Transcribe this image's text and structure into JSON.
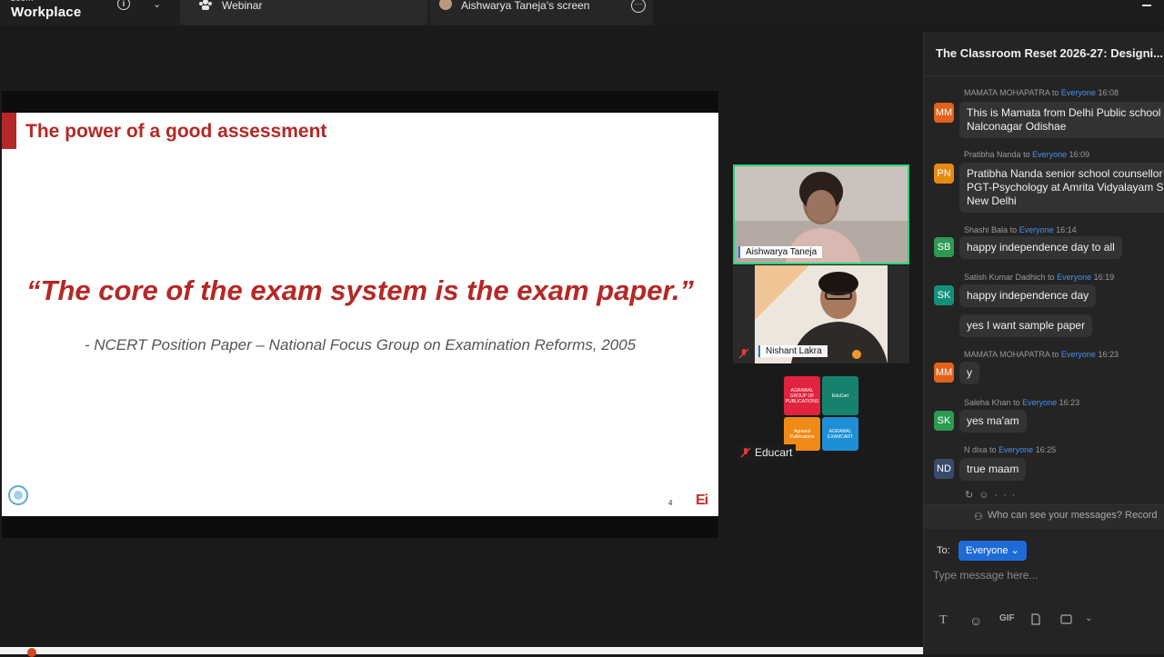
{
  "app": {
    "brand_small": "zoom",
    "brand_big": "Workplace"
  },
  "tabs": [
    {
      "label": "Webinar"
    },
    {
      "label": "Aishwarya Taneja's screen"
    }
  ],
  "slide": {
    "title": "The power of a good assessment",
    "quote": "“The core of the exam system is the exam paper.”",
    "source": "- NCERT Position Paper – National Focus Group on Examination Reforms, 2005",
    "page_number": "4",
    "brand": "Ei"
  },
  "participants": [
    {
      "name": "Aishwarya Taneja"
    },
    {
      "name": "Nishant Lakra"
    },
    {
      "name": "Educart"
    }
  ],
  "educart_logo": {
    "cells": [
      "AGRAWAL GROUP OF PUBLICATIONS",
      "EduCart",
      "Agrawal Publications",
      "AGRAWAL EXAMCART"
    ]
  },
  "chat": {
    "title": "The Classroom Reset 2026-27: Designi...",
    "to_word": "to",
    "messages": [
      {
        "sender": "MAMATA MOHAPATRA",
        "recipient": "Everyone",
        "time": "16:08",
        "initials": "MM",
        "color": "#e2621b",
        "lines": [
          "This is Mamata from Delhi Public school",
          "Nalconagar Odishae"
        ]
      },
      {
        "sender": "Pratibha Nanda",
        "recipient": "Everyone",
        "time": "16:09",
        "initials": "PN",
        "color": "#e88a12",
        "lines": [
          "Pratibha Nanda senior school counsellor",
          "PGT-Psychology at Amrita Vidyalayam Sa",
          "New Delhi"
        ]
      },
      {
        "sender": "Shashi Bala",
        "recipient": "Everyone",
        "time": "16:14",
        "initials": "SB",
        "color": "#2c9a54",
        "lines": [
          "happy independence day to all"
        ]
      },
      {
        "sender": "Satish Kumar Dadhich",
        "recipient": "Everyone",
        "time": "16:19",
        "initials": "SK",
        "color": "#13907a",
        "lines": [
          "happy independence day"
        ],
        "extra": "yes I want sample paper"
      },
      {
        "sender": "MAMATA MOHAPATRA",
        "recipient": "Everyone",
        "time": "16:23",
        "initials": "MM",
        "color": "#e2621b",
        "lines": [
          "y"
        ]
      },
      {
        "sender": "Saleha Khan",
        "recipient": "Everyone",
        "time": "16:23",
        "initials": "SK",
        "color": "#2c9a54",
        "lines": [
          "yes ma'am"
        ]
      },
      {
        "sender": "N dixa",
        "recipient": "Everyone",
        "time": "16:25",
        "initials": "ND",
        "color": "#3a4a6b",
        "lines": [
          "true maam"
        ]
      }
    ],
    "privacy_text": "Who can see your messages? Record",
    "to_label": "To:",
    "to_value": "Everyone",
    "input_placeholder": "Type message here...",
    "toolbar": [
      "T",
      "☺",
      "GIF",
      "file",
      "screenshot",
      "▾"
    ]
  }
}
